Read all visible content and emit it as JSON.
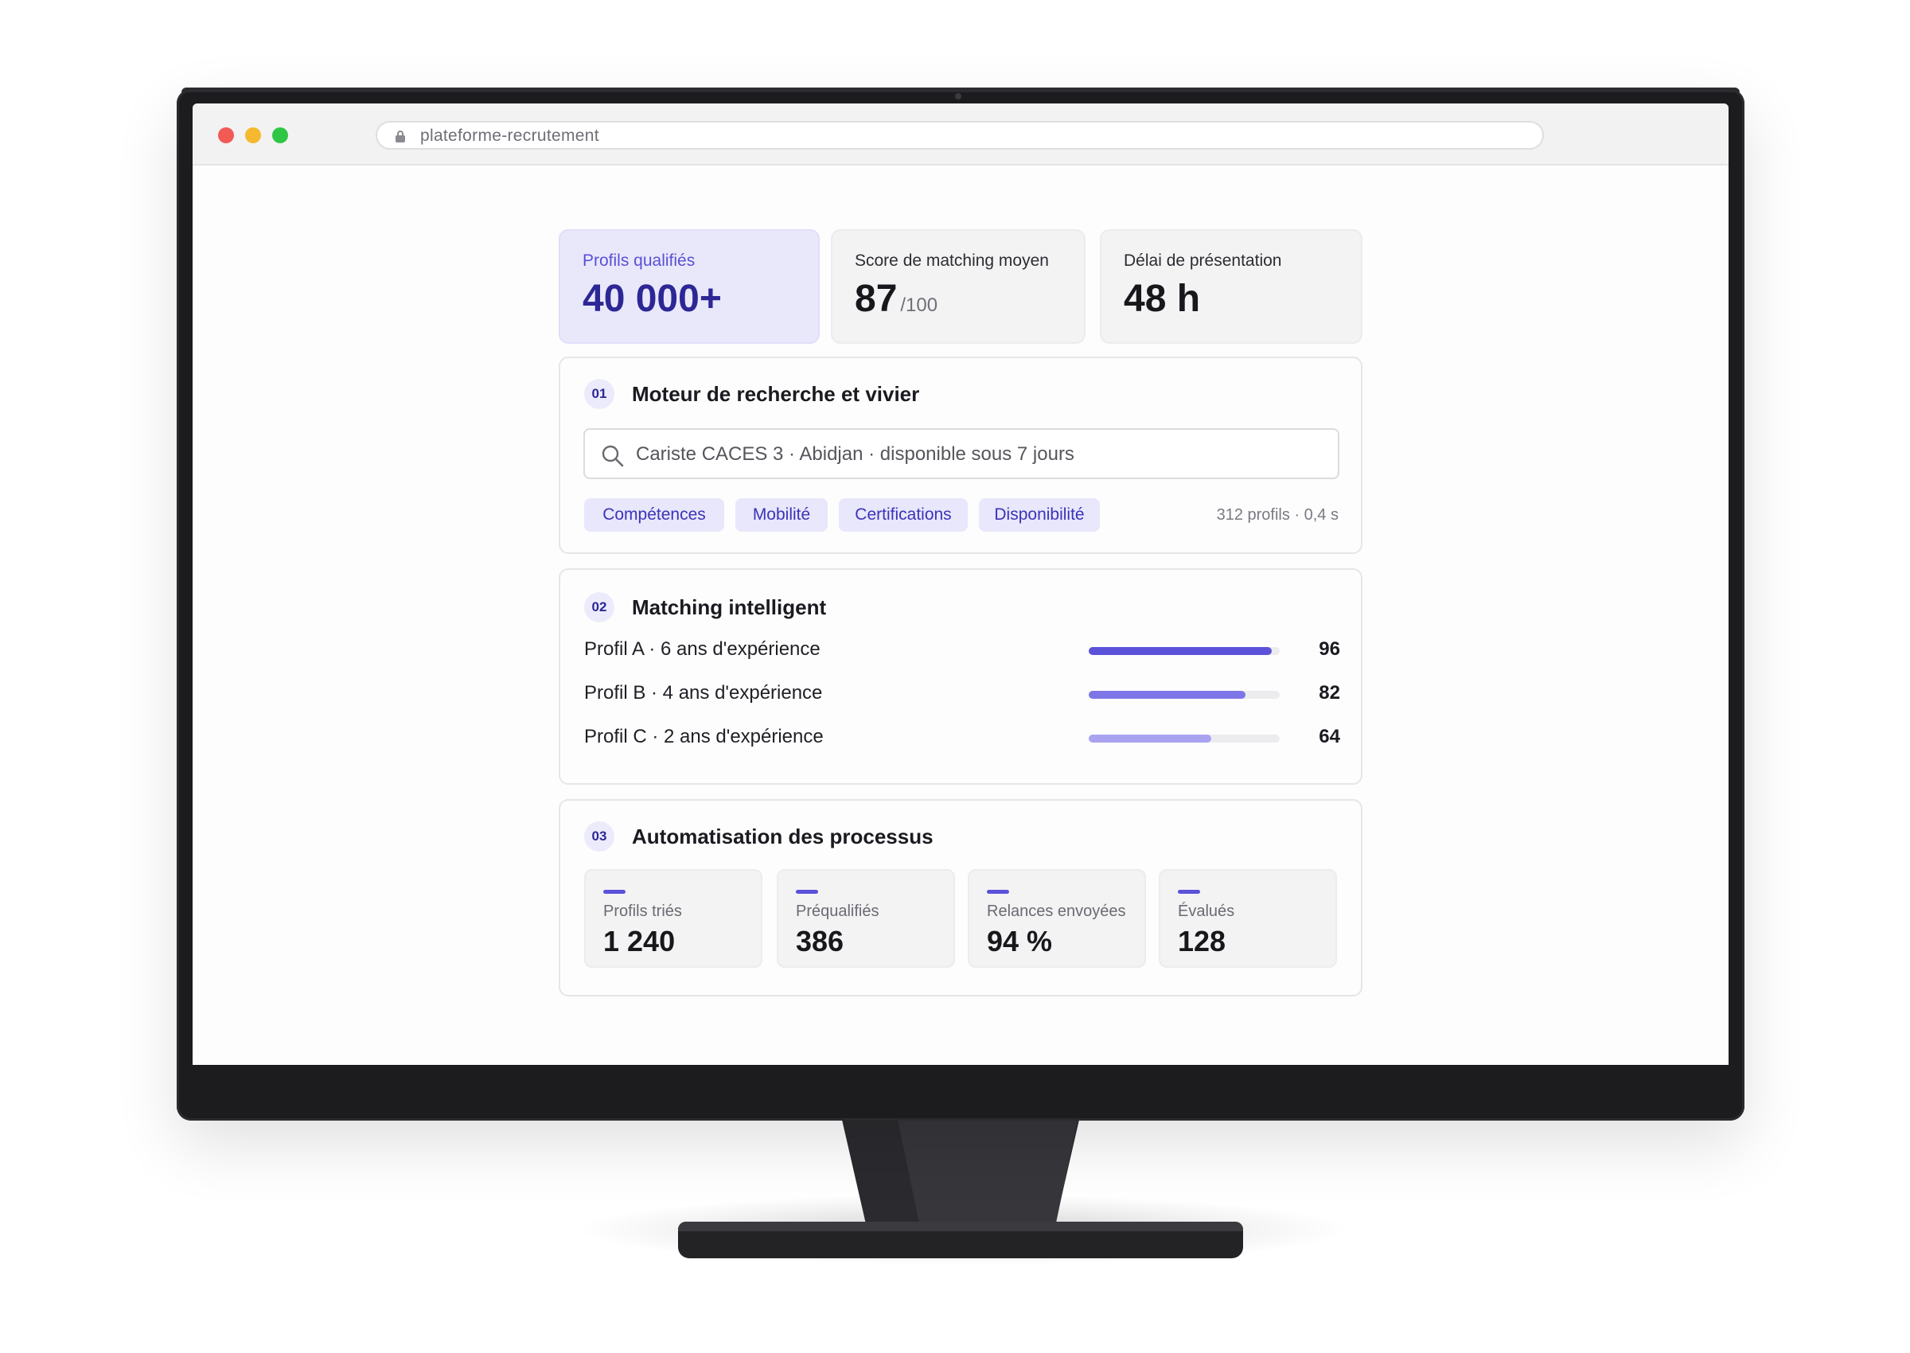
{
  "browser": {
    "url": "plateforme-recrutement"
  },
  "kpis": [
    {
      "label": "Profils qualifiés",
      "value": "40 000+",
      "unit": ""
    },
    {
      "label": "Score de matching moyen",
      "value": "87",
      "unit": "/100"
    },
    {
      "label": "Délai de présentation",
      "value": "48 h",
      "unit": ""
    }
  ],
  "search_section": {
    "number": "01",
    "title": "Moteur de recherche et vivier",
    "query": "Cariste CACES 3  ·  Abidjan  · disponible sous 7 jours",
    "filters": [
      "Compétences",
      "Mobilité",
      "Certifications",
      "Disponibilité"
    ],
    "result_meta": "312 profils · 0,4 s"
  },
  "matching_section": {
    "number": "02",
    "title": "Matching intelligent",
    "profiles": [
      {
        "name": "Profil A  ·  6 ans d'expérience",
        "score": 96,
        "score_label": "96",
        "color": "#5b52d9"
      },
      {
        "name": "Profil B  ·  4 ans d'expérience",
        "score": 82,
        "score_label": "82",
        "color": "#7e76e6"
      },
      {
        "name": "Profil C  ·  2 ans d'expérience",
        "score": 64,
        "score_label": "64",
        "color": "#a8a2f0"
      }
    ]
  },
  "automation_section": {
    "number": "03",
    "title": "Automatisation des processus",
    "stats": [
      {
        "label": "Profils triés",
        "value": "1 240"
      },
      {
        "label": "Préqualifiés",
        "value": "386"
      },
      {
        "label": "Relances envoyées",
        "value": "94 %"
      },
      {
        "label": "Évalués",
        "value": "128"
      }
    ]
  },
  "colors": {
    "accent": "#5b52d9",
    "accent_dark": "#2d2796",
    "accent_soft": "#e9e8fb"
  }
}
